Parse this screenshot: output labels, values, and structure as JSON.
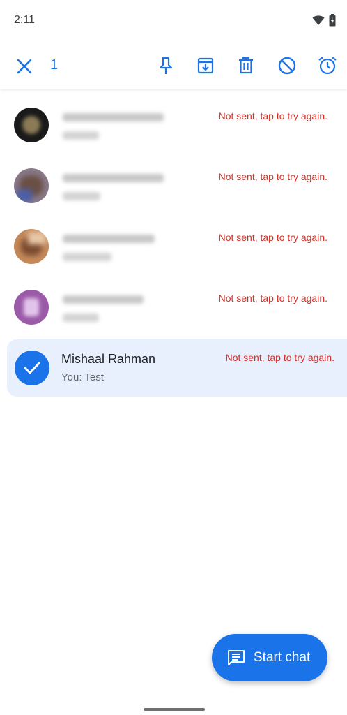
{
  "status_bar": {
    "time": "2:11",
    "icons": [
      "wifi-icon",
      "battery-icon"
    ]
  },
  "toolbar": {
    "selected_count": "1",
    "actions": [
      "close-icon",
      "pin-icon",
      "archive-icon",
      "delete-icon",
      "block-icon",
      "snooze-icon"
    ],
    "accent_color": "#1a73e8"
  },
  "conversations": [
    {
      "status": "Not sent, tap to try again.",
      "blurred": true
    },
    {
      "status": "Not sent, tap to try again.",
      "blurred": true
    },
    {
      "status": "Not sent, tap to try again.",
      "blurred": true
    },
    {
      "status": "Not sent, tap to try again.",
      "blurred": true
    },
    {
      "name": "Mishaal Rahman",
      "snippet": "You: Test",
      "status": "Not sent, tap to try again.",
      "selected": true
    }
  ],
  "fab": {
    "label": "Start chat",
    "icon": "message-icon"
  },
  "colors": {
    "error": "#d93025",
    "selected_bg": "#e8f0fe",
    "primary": "#1a73e8"
  }
}
